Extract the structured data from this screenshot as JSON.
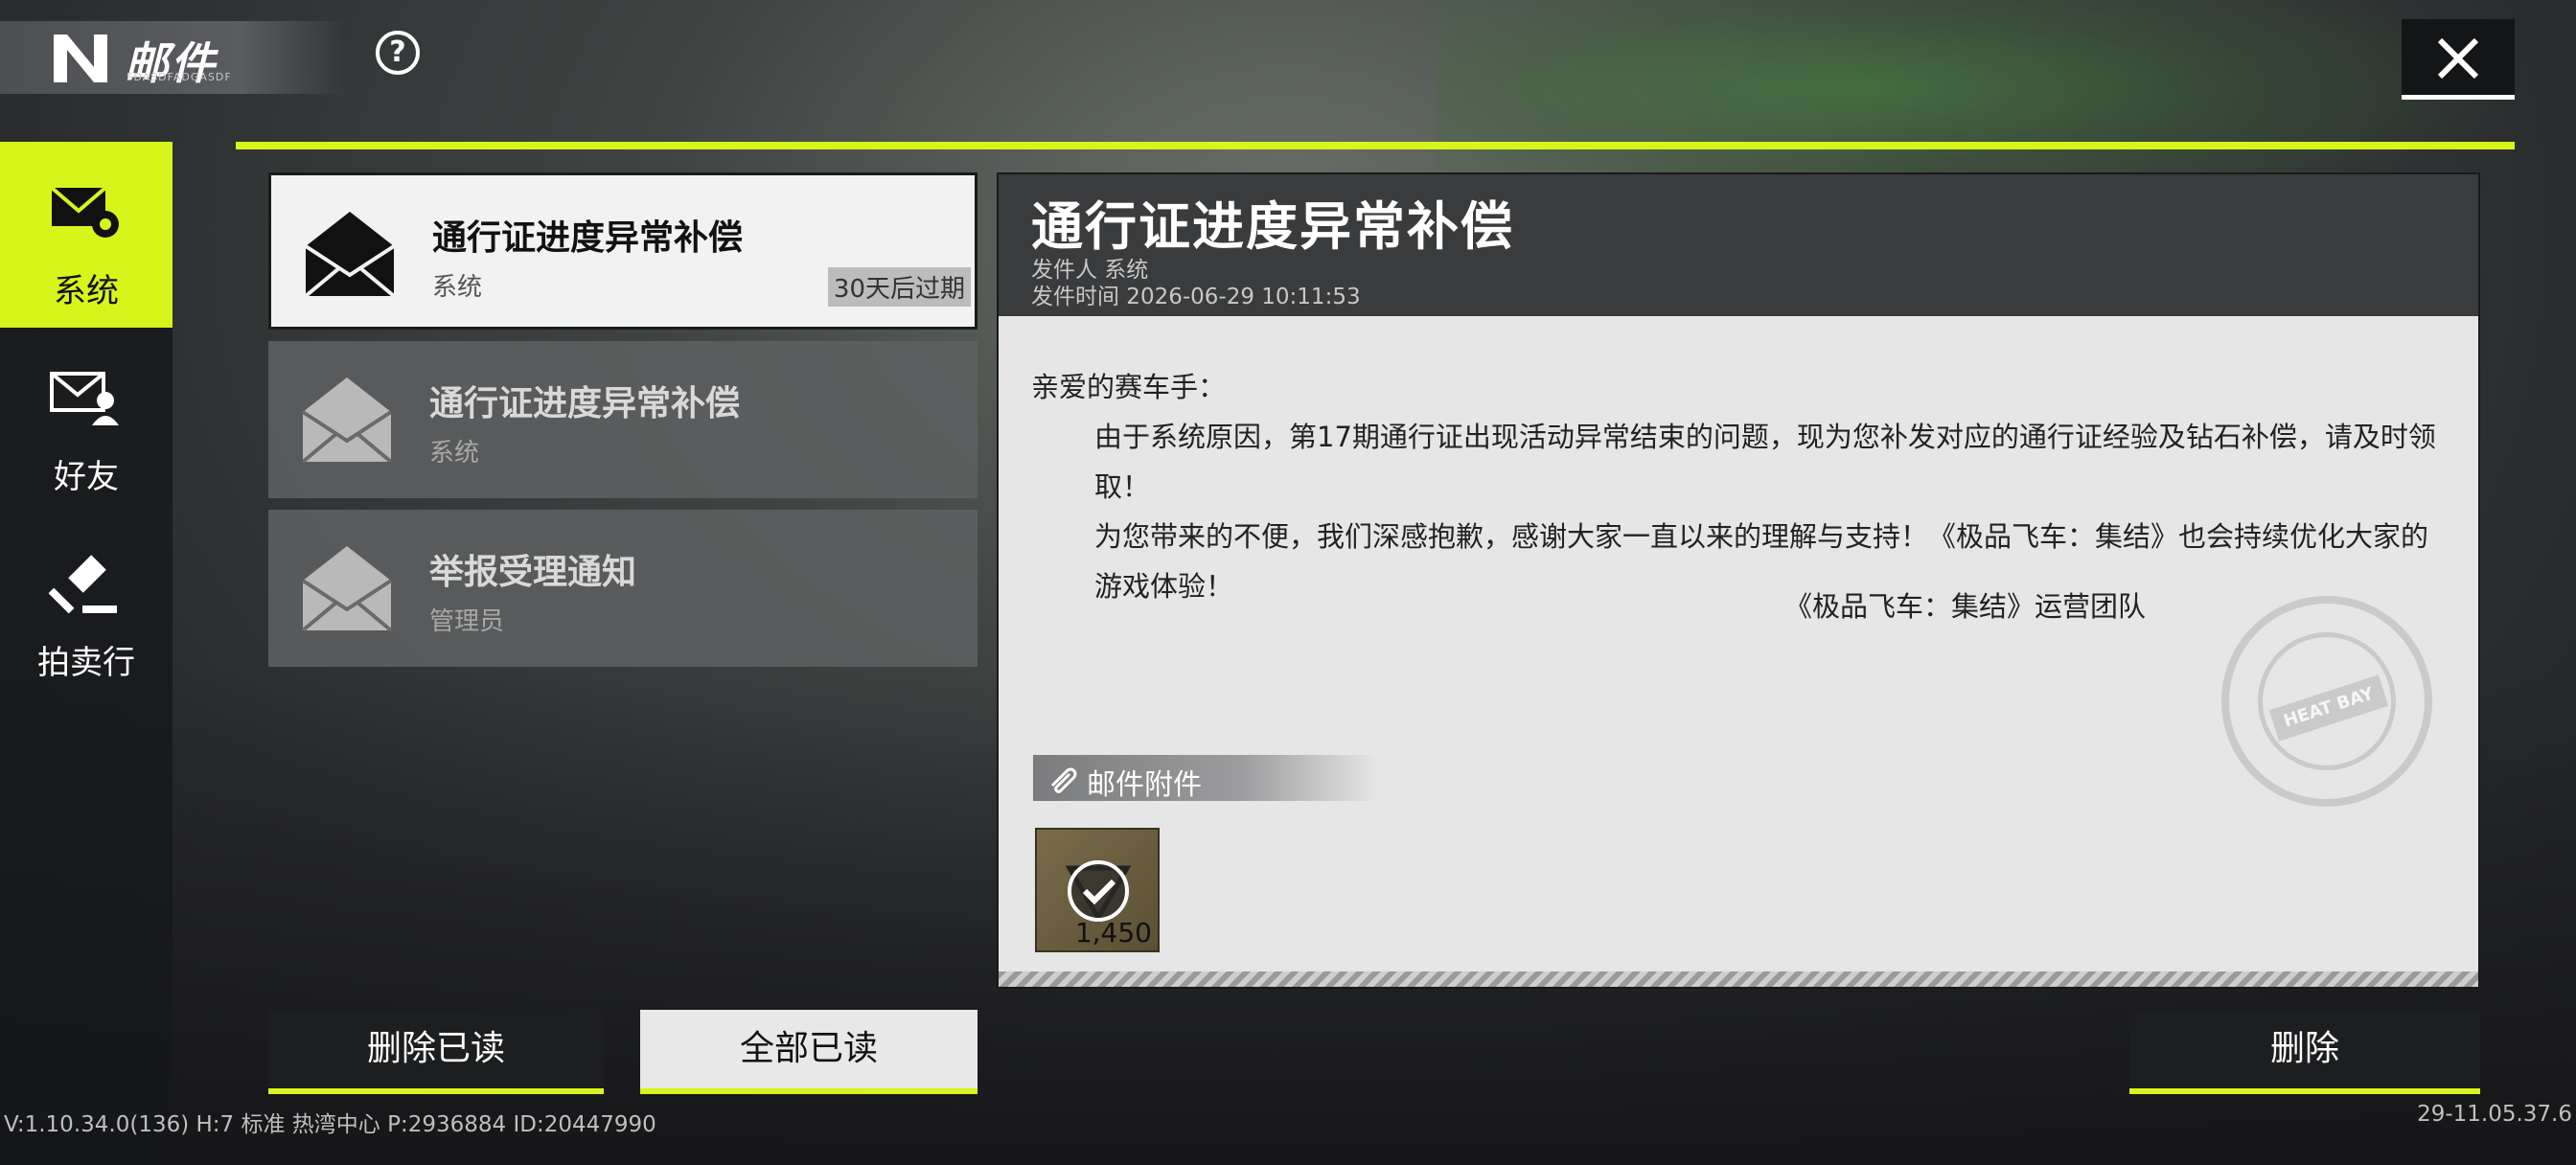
{
  "header": {
    "title": "邮件",
    "subtitle": "FDASDFADGASDF",
    "help_icon": "?",
    "close_icon": "close"
  },
  "sidebar": {
    "items": [
      {
        "label": "系统",
        "icon": "mail-gear-icon",
        "active": true
      },
      {
        "label": "好友",
        "icon": "mail-person-icon",
        "active": false
      },
      {
        "label": "拍卖行",
        "icon": "gavel-icon",
        "active": false
      }
    ]
  },
  "mail_list": [
    {
      "title": "通行证进度异常补偿",
      "sender": "系统",
      "expire": "30天后过期",
      "selected": true
    },
    {
      "title": "通行证进度异常补偿",
      "sender": "系统",
      "selected": false
    },
    {
      "title": "举报受理通知",
      "sender": "管理员",
      "selected": false
    }
  ],
  "detail": {
    "title": "通行证进度异常补偿",
    "sender_line": "发件人 系统",
    "time_line": "发件时间  2026-06-29 10:11:53",
    "greeting": "亲爱的赛车手：",
    "para1": "由于系统原因，第17期通行证出现活动异常结束的问题，现为您补发对应的通行证经验及钻石补偿，请及时领取！",
    "para2": "为您带来的不便，我们深感抱歉，感谢大家一直以来的理解与支持！《极品飞车：集结》也会持续优化大家的游戏体验！",
    "signature": "《极品飞车：集结》运营团队",
    "stamp_text": "HEAT BAY",
    "attachment_label": "邮件附件",
    "attachment_item": {
      "icon": "diamond-claimed-icon",
      "qty": "1,450"
    }
  },
  "buttons": {
    "delete_read": "删除已读",
    "mark_all_read": "全部已读",
    "delete": "删除"
  },
  "footer": {
    "version": "V:1.10.34.0(136) H:7 标准 热湾中心 P:2936884 ID:20447990",
    "build": "29-11.05.37.6"
  },
  "colors": {
    "accent": "#d7f51a"
  }
}
